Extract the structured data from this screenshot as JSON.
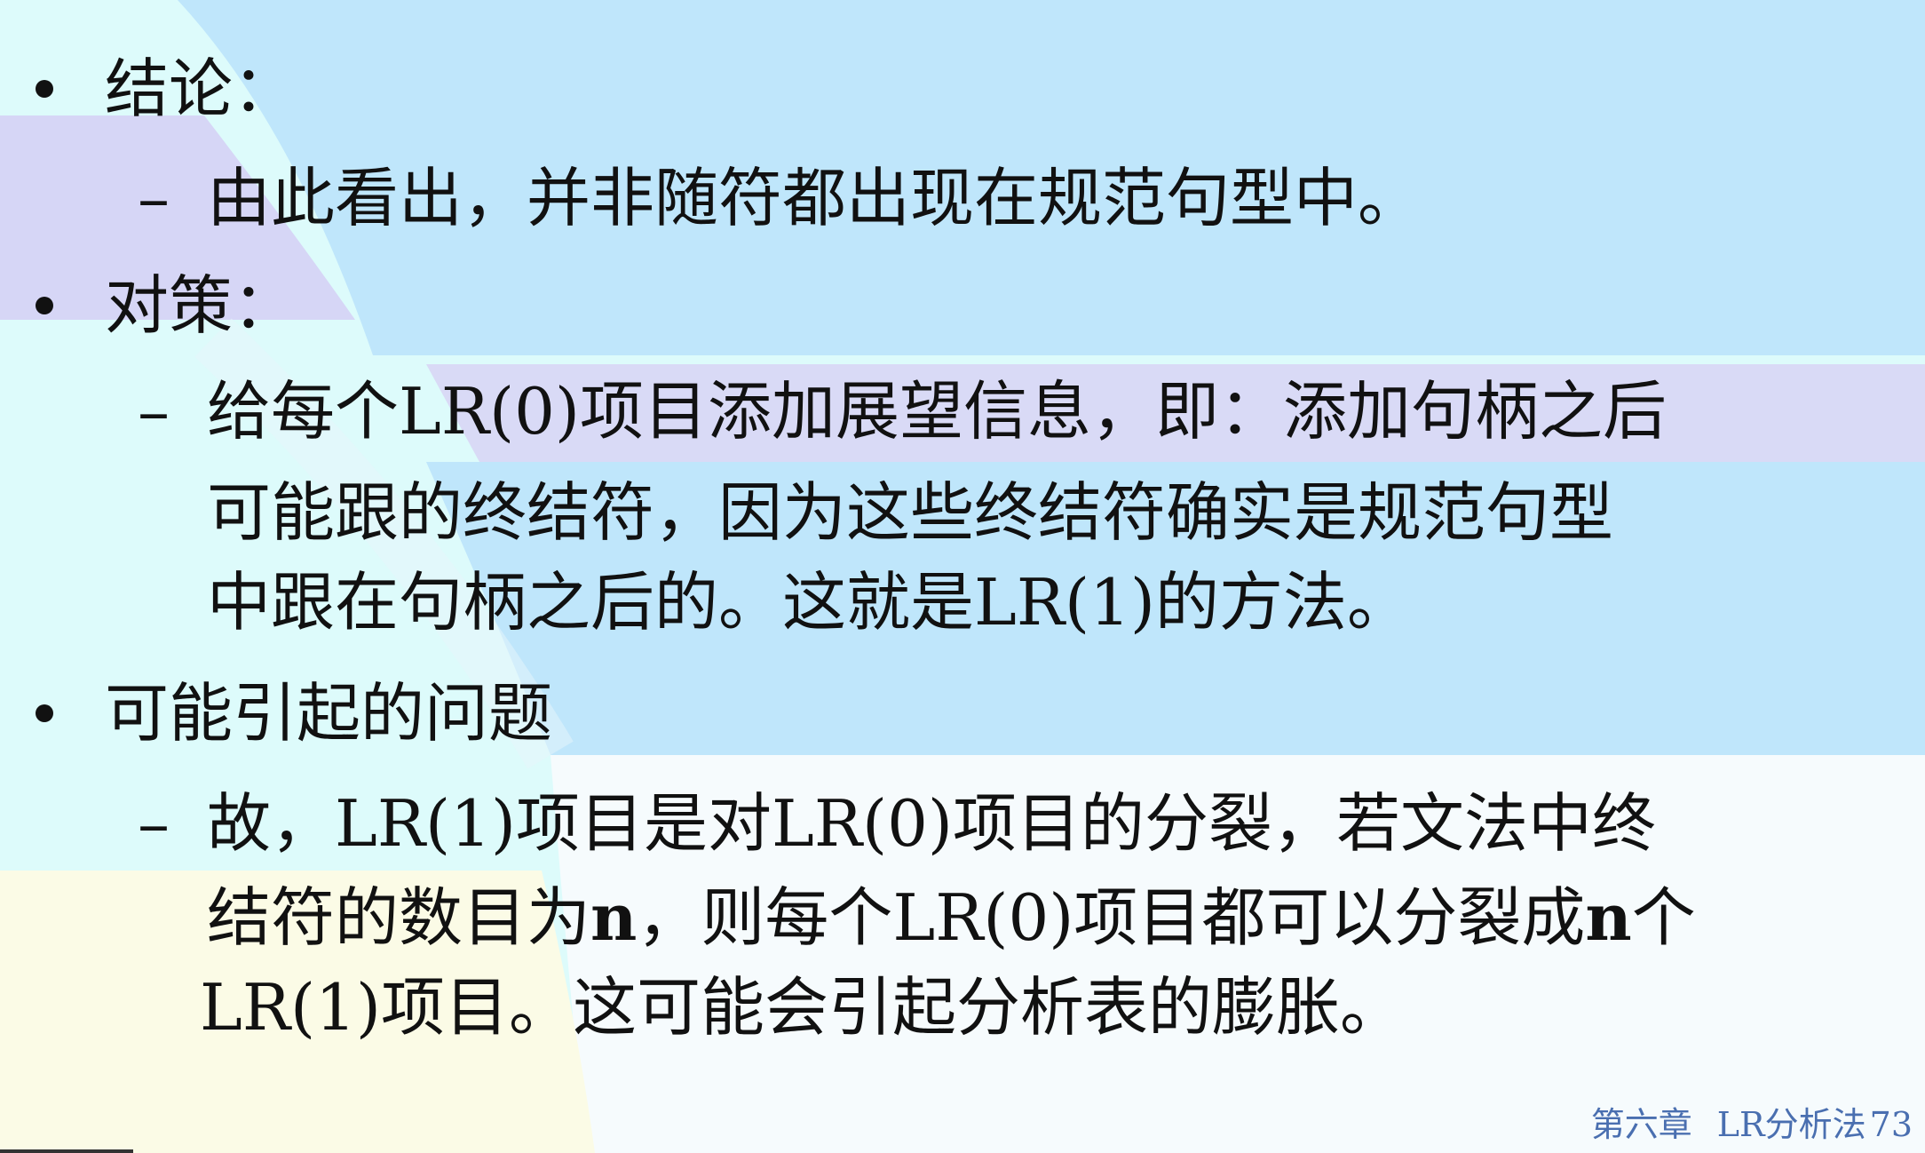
{
  "slide": {
    "bullets": [
      {
        "label": "结论："
      },
      {
        "label": "对策："
      },
      {
        "label": "可能引起的问题"
      }
    ],
    "conclusion_text": "由此看出，并非随符都出现在规范句型中。",
    "strategy_lines": [
      "给每个LR(0)项目添加展望信息，即：添加句柄之后",
      "可能跟的终结符，因为这些终结符确实是规范句型",
      "中跟在句柄之后的。这就是LR(1)的方法。"
    ],
    "problem_line1": "故，LR(1)项目是对LR(0)项目的分裂，若文法中终",
    "problem_line2_a": "结符的数目为",
    "problem_line2_n1": "n",
    "problem_line2_b": "，则每个LR(0)项目都可以分裂成",
    "problem_line2_n2": "n",
    "problem_line2_c": "个",
    "problem_line3": "LR(1)项目。这可能会引起分析表的膨胀。",
    "dash": "–"
  },
  "footer": {
    "chapter": "第六章",
    "title": "LR分析法",
    "page": "73"
  },
  "colors": {
    "bg_blue": "#bfe6fb",
    "bg_lavender": "#d6d6f6",
    "bg_cyan": "#ddfbfb",
    "bg_white": "#f6fbfd",
    "bg_yellow": "#fbfbe6",
    "footer_text": "#4a6fb0"
  }
}
